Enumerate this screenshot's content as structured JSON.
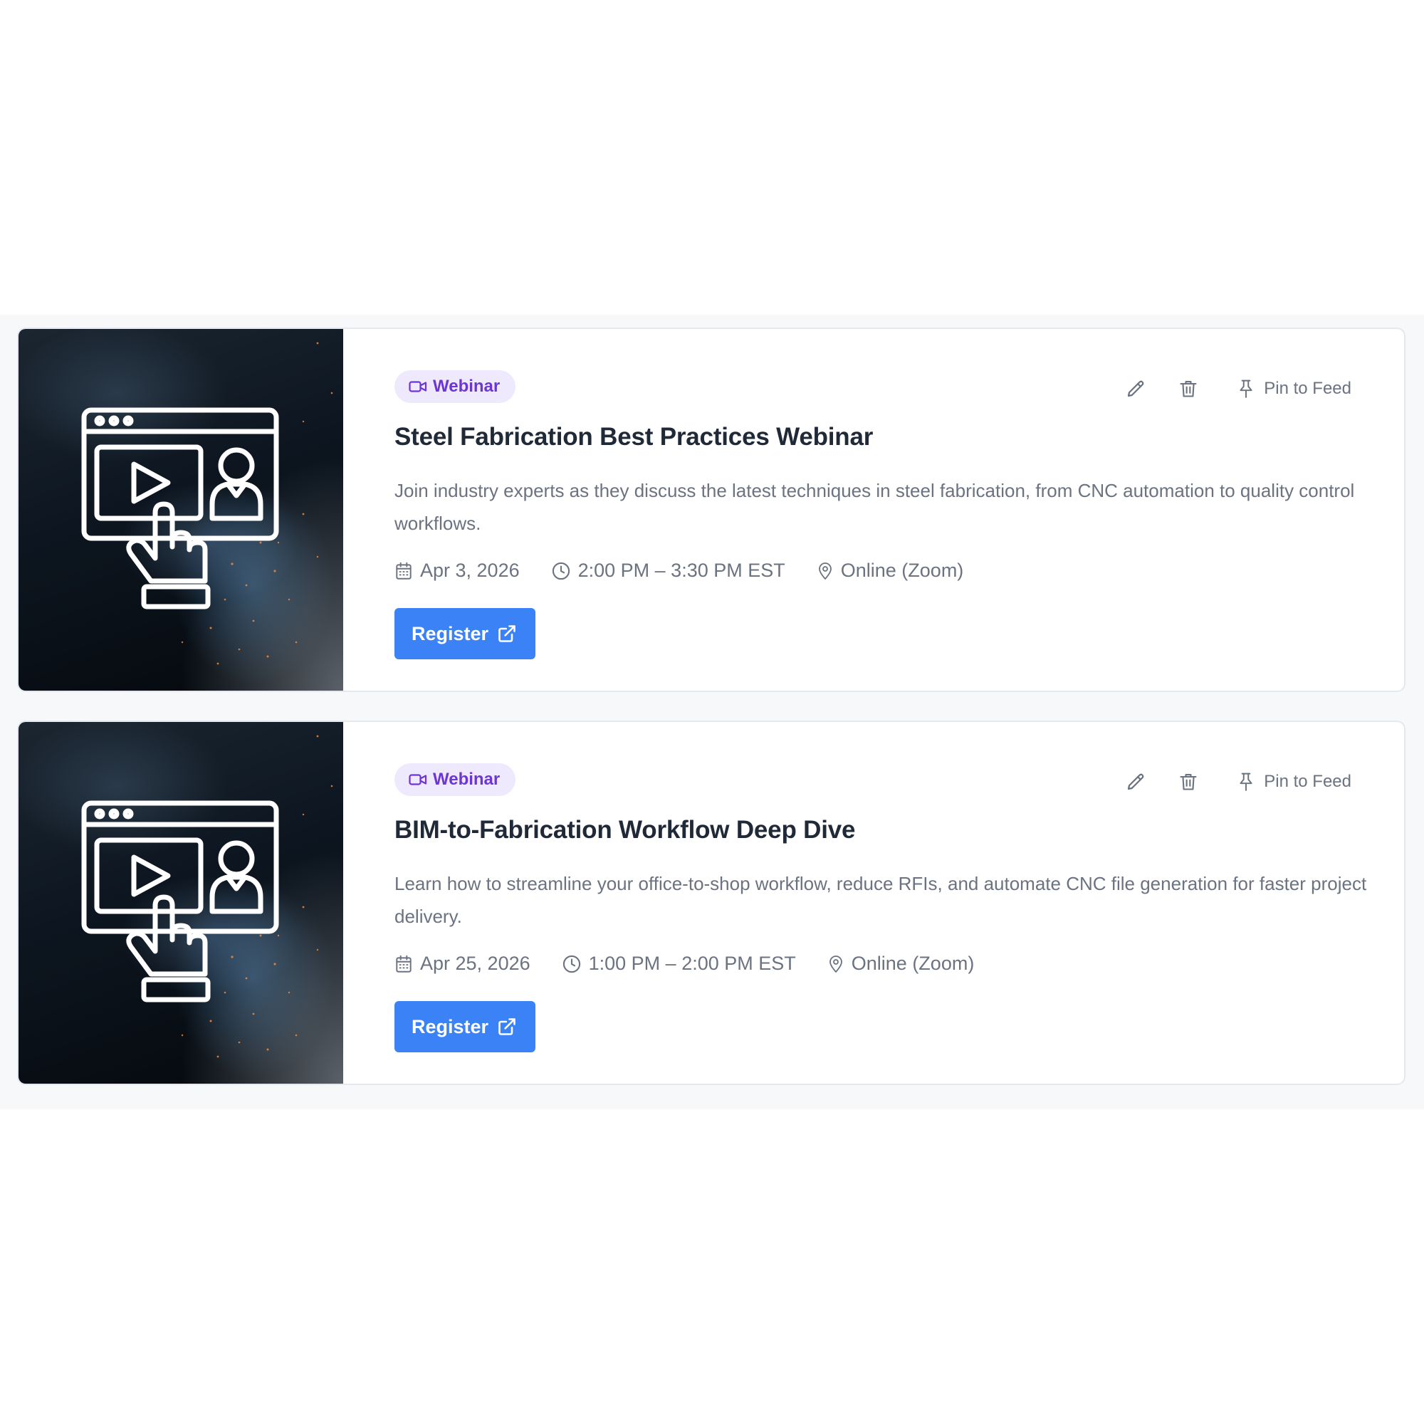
{
  "events": [
    {
      "badge": "Webinar",
      "title": "Steel Fabrication Best Practices Webinar",
      "description": "Join industry experts as they discuss the latest techniques in steel fabrication, from CNC automation to quality control workflows.",
      "date": "Apr 3, 2026",
      "time": "2:00 PM – 3:30 PM EST",
      "location": "Online (Zoom)",
      "register_label": "Register",
      "pin_label": "Pin to Feed"
    },
    {
      "badge": "Webinar",
      "title": "BIM-to-Fabrication Workflow Deep Dive",
      "description": "Learn how to streamline your office-to-shop workflow, reduce RFIs, and automate CNC file generation for faster project delivery.",
      "date": "Apr 25, 2026",
      "time": "1:00 PM – 2:00 PM EST",
      "location": "Online (Zoom)",
      "register_label": "Register",
      "pin_label": "Pin to Feed"
    }
  ],
  "icons": {
    "badge": "video-camera-icon",
    "edit": "pencil-icon",
    "delete": "trash-icon",
    "pin": "pin-icon",
    "date": "calendar-icon",
    "time": "clock-icon",
    "location": "map-pin-icon",
    "external": "external-link-icon",
    "thumbnail": "webinar-screen-icon"
  },
  "colors": {
    "accent": "#3b82f6",
    "badge_bg": "#efe9fd",
    "badge_text": "#6d35d6",
    "title": "#1f2937",
    "muted": "#6b7280"
  }
}
